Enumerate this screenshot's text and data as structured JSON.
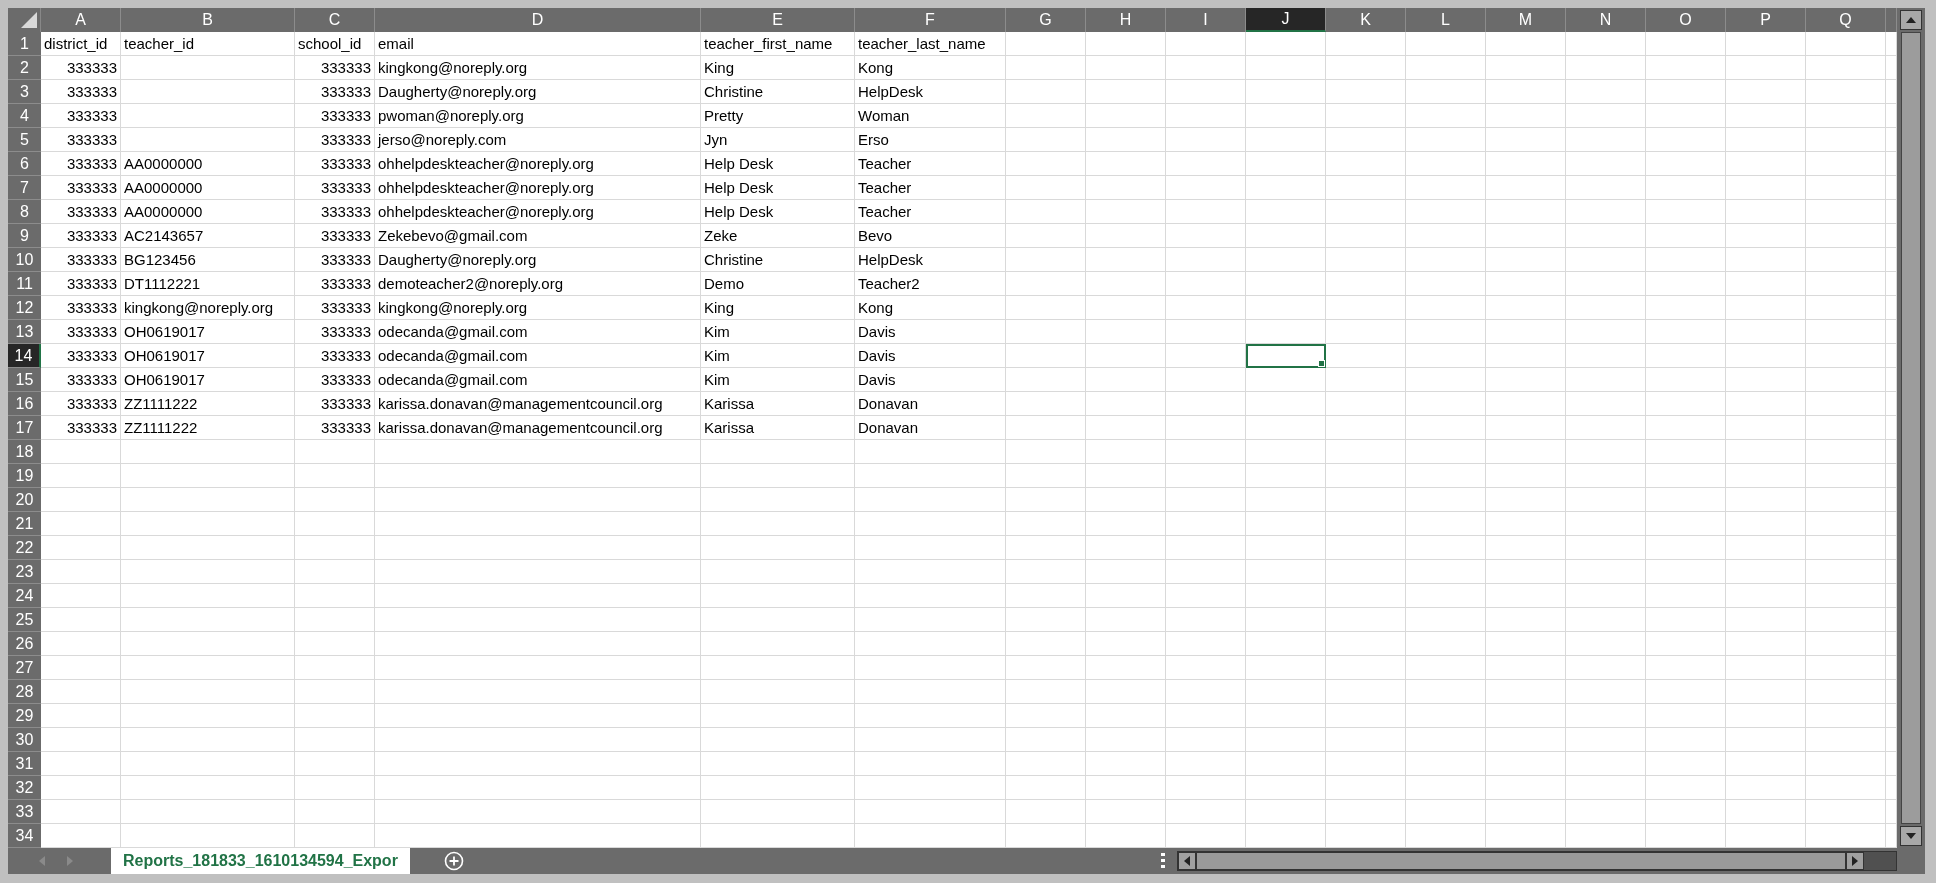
{
  "columns": [
    {
      "label": "A",
      "selected": false
    },
    {
      "label": "B",
      "selected": false
    },
    {
      "label": "C",
      "selected": false
    },
    {
      "label": "D",
      "selected": false
    },
    {
      "label": "E",
      "selected": false
    },
    {
      "label": "F",
      "selected": false
    },
    {
      "label": "G",
      "selected": false
    },
    {
      "label": "H",
      "selected": false
    },
    {
      "label": "I",
      "selected": false
    },
    {
      "label": "J",
      "selected": true
    },
    {
      "label": "K",
      "selected": false
    },
    {
      "label": "L",
      "selected": false
    },
    {
      "label": "M",
      "selected": false
    },
    {
      "label": "N",
      "selected": false
    },
    {
      "label": "O",
      "selected": false
    },
    {
      "label": "P",
      "selected": false
    },
    {
      "label": "Q",
      "selected": false
    }
  ],
  "rows": [
    {
      "number": "1",
      "selected": false,
      "cells": [
        {
          "value": "district_id",
          "kind": "text"
        },
        {
          "value": "teacher_id",
          "kind": "text"
        },
        {
          "value": "school_id",
          "kind": "text"
        },
        {
          "value": "email",
          "kind": "text"
        },
        {
          "value": "teacher_first_name",
          "kind": "text"
        },
        {
          "value": "teacher_last_name",
          "kind": "text"
        }
      ]
    },
    {
      "number": "2",
      "selected": false,
      "cells": [
        {
          "value": "333333",
          "kind": "number"
        },
        null,
        {
          "value": "333333",
          "kind": "number"
        },
        {
          "value": "kingkong@noreply.org",
          "kind": "text"
        },
        {
          "value": "King",
          "kind": "text"
        },
        {
          "value": "Kong",
          "kind": "text"
        }
      ]
    },
    {
      "number": "3",
      "selected": false,
      "cells": [
        {
          "value": "333333",
          "kind": "number"
        },
        null,
        {
          "value": "333333",
          "kind": "number"
        },
        {
          "value": "Daugherty@noreply.org",
          "kind": "text"
        },
        {
          "value": "Christine",
          "kind": "text"
        },
        {
          "value": "HelpDesk",
          "kind": "text"
        }
      ]
    },
    {
      "number": "4",
      "selected": false,
      "cells": [
        {
          "value": "333333",
          "kind": "number"
        },
        null,
        {
          "value": "333333",
          "kind": "number"
        },
        {
          "value": "pwoman@noreply.org",
          "kind": "text"
        },
        {
          "value": "Pretty",
          "kind": "text"
        },
        {
          "value": "Woman",
          "kind": "text"
        }
      ]
    },
    {
      "number": "5",
      "selected": false,
      "cells": [
        {
          "value": "333333",
          "kind": "number"
        },
        null,
        {
          "value": "333333",
          "kind": "number"
        },
        {
          "value": "jerso@noreply.com",
          "kind": "text"
        },
        {
          "value": "Jyn",
          "kind": "text"
        },
        {
          "value": "Erso",
          "kind": "text"
        }
      ]
    },
    {
      "number": "6",
      "selected": false,
      "cells": [
        {
          "value": "333333",
          "kind": "number"
        },
        {
          "value": "AA0000000",
          "kind": "text"
        },
        {
          "value": "333333",
          "kind": "number"
        },
        {
          "value": "ohhelpdeskteacher@noreply.org",
          "kind": "text"
        },
        {
          "value": "Help Desk",
          "kind": "text"
        },
        {
          "value": "Teacher",
          "kind": "text"
        }
      ]
    },
    {
      "number": "7",
      "selected": false,
      "cells": [
        {
          "value": "333333",
          "kind": "number"
        },
        {
          "value": "AA0000000",
          "kind": "text"
        },
        {
          "value": "333333",
          "kind": "number"
        },
        {
          "value": "ohhelpdeskteacher@noreply.org",
          "kind": "text"
        },
        {
          "value": "Help Desk",
          "kind": "text"
        },
        {
          "value": "Teacher",
          "kind": "text"
        }
      ]
    },
    {
      "number": "8",
      "selected": false,
      "cells": [
        {
          "value": "333333",
          "kind": "number"
        },
        {
          "value": "AA0000000",
          "kind": "text"
        },
        {
          "value": "333333",
          "kind": "number"
        },
        {
          "value": "ohhelpdeskteacher@noreply.org",
          "kind": "text"
        },
        {
          "value": "Help Desk",
          "kind": "text"
        },
        {
          "value": "Teacher",
          "kind": "text"
        }
      ]
    },
    {
      "number": "9",
      "selected": false,
      "cells": [
        {
          "value": "333333",
          "kind": "number"
        },
        {
          "value": "AC2143657",
          "kind": "text"
        },
        {
          "value": "333333",
          "kind": "number"
        },
        {
          "value": "Zekebevo@gmail.com",
          "kind": "text"
        },
        {
          "value": "Zeke",
          "kind": "text"
        },
        {
          "value": "Bevo",
          "kind": "text"
        }
      ]
    },
    {
      "number": "10",
      "selected": false,
      "cells": [
        {
          "value": "333333",
          "kind": "number"
        },
        {
          "value": "BG123456",
          "kind": "text"
        },
        {
          "value": "333333",
          "kind": "number"
        },
        {
          "value": "Daugherty@noreply.org",
          "kind": "text"
        },
        {
          "value": "Christine",
          "kind": "text"
        },
        {
          "value": "HelpDesk",
          "kind": "text"
        }
      ]
    },
    {
      "number": "11",
      "selected": false,
      "cells": [
        {
          "value": "333333",
          "kind": "number"
        },
        {
          "value": "DT1112221",
          "kind": "text"
        },
        {
          "value": "333333",
          "kind": "number"
        },
        {
          "value": "demoteacher2@noreply.org",
          "kind": "text"
        },
        {
          "value": "Demo",
          "kind": "text"
        },
        {
          "value": "Teacher2",
          "kind": "text"
        }
      ]
    },
    {
      "number": "12",
      "selected": false,
      "cells": [
        {
          "value": "333333",
          "kind": "number"
        },
        {
          "value": "kingkong@noreply.org",
          "kind": "text"
        },
        {
          "value": "333333",
          "kind": "number"
        },
        {
          "value": "kingkong@noreply.org",
          "kind": "text"
        },
        {
          "value": "King",
          "kind": "text"
        },
        {
          "value": "Kong",
          "kind": "text"
        }
      ]
    },
    {
      "number": "13",
      "selected": false,
      "cells": [
        {
          "value": "333333",
          "kind": "number"
        },
        {
          "value": "OH0619017",
          "kind": "text"
        },
        {
          "value": "333333",
          "kind": "number"
        },
        {
          "value": "odecanda@gmail.com",
          "kind": "text"
        },
        {
          "value": "Kim",
          "kind": "text"
        },
        {
          "value": "Davis",
          "kind": "text"
        }
      ]
    },
    {
      "number": "14",
      "selected": true,
      "cells": [
        {
          "value": "333333",
          "kind": "number"
        },
        {
          "value": "OH0619017",
          "kind": "text"
        },
        {
          "value": "333333",
          "kind": "number"
        },
        {
          "value": "odecanda@gmail.com",
          "kind": "text"
        },
        {
          "value": "Kim",
          "kind": "text"
        },
        {
          "value": "Davis",
          "kind": "text"
        }
      ]
    },
    {
      "number": "15",
      "selected": false,
      "cells": [
        {
          "value": "333333",
          "kind": "number"
        },
        {
          "value": "OH0619017",
          "kind": "text"
        },
        {
          "value": "333333",
          "kind": "number"
        },
        {
          "value": "odecanda@gmail.com",
          "kind": "text"
        },
        {
          "value": "Kim",
          "kind": "text"
        },
        {
          "value": "Davis",
          "kind": "text"
        }
      ]
    },
    {
      "number": "16",
      "selected": false,
      "cells": [
        {
          "value": "333333",
          "kind": "number"
        },
        {
          "value": "ZZ1111222",
          "kind": "text"
        },
        {
          "value": "333333",
          "kind": "number"
        },
        {
          "value": "karissa.donavan@managementcouncil.org",
          "kind": "text"
        },
        {
          "value": "Karissa",
          "kind": "text"
        },
        {
          "value": "Donavan",
          "kind": "text"
        }
      ]
    },
    {
      "number": "17",
      "selected": false,
      "cells": [
        {
          "value": "333333",
          "kind": "number"
        },
        {
          "value": "ZZ1111222",
          "kind": "text"
        },
        {
          "value": "333333",
          "kind": "number"
        },
        {
          "value": "karissa.donavan@managementcouncil.org",
          "kind": "text"
        },
        {
          "value": "Karissa",
          "kind": "text"
        },
        {
          "value": "Donavan",
          "kind": "text"
        }
      ]
    },
    {
      "number": "18",
      "selected": false
    },
    {
      "number": "19",
      "selected": false
    },
    {
      "number": "20",
      "selected": false
    },
    {
      "number": "21",
      "selected": false
    },
    {
      "number": "22",
      "selected": false
    },
    {
      "number": "23",
      "selected": false
    },
    {
      "number": "24",
      "selected": false
    },
    {
      "number": "25",
      "selected": false
    },
    {
      "number": "26",
      "selected": false
    },
    {
      "number": "27",
      "selected": false
    },
    {
      "number": "28",
      "selected": false
    },
    {
      "number": "29",
      "selected": false
    },
    {
      "number": "30",
      "selected": false
    },
    {
      "number": "31",
      "selected": false
    },
    {
      "number": "32",
      "selected": false
    },
    {
      "number": "33",
      "selected": false
    },
    {
      "number": "34",
      "selected": false
    }
  ],
  "sheet_tabs": [
    {
      "label": "Reports_181833_1610134594_Expor",
      "selected": true
    }
  ]
}
